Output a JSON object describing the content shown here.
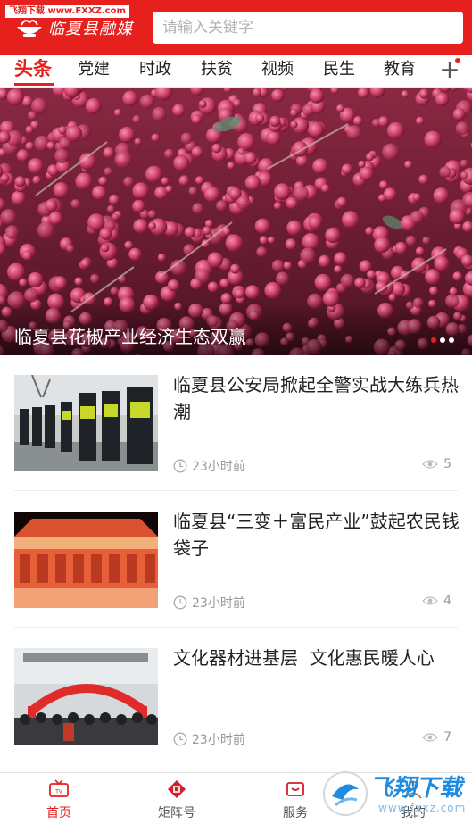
{
  "watermark_top": "飞翔下载 www.FXXZ.com",
  "header": {
    "app_name": "临夏县融媒",
    "search_placeholder": "请输入关键字"
  },
  "tabs": [
    {
      "label": "头条",
      "active": true
    },
    {
      "label": "党建"
    },
    {
      "label": "时政"
    },
    {
      "label": "扶贫"
    },
    {
      "label": "视频"
    },
    {
      "label": "民生"
    },
    {
      "label": "教育"
    }
  ],
  "tab_add_label": "+",
  "banner": {
    "title": "临夏县花椒产业经济生态双赢",
    "slide_index": 1,
    "slide_count": 3
  },
  "news": [
    {
      "title": "临夏县公安局掀起全警实战大练兵热潮",
      "time": "23小时前",
      "views": "5"
    },
    {
      "title": "临夏县“三变＋富民产业”鼓起农民钱袋子",
      "time": "23小时前",
      "views": "4"
    },
    {
      "title": "文化器材进基层  文化惠民暖人心",
      "time": "23小时前",
      "views": "7"
    }
  ],
  "bottom_nav": [
    {
      "label": "首页",
      "icon": "tv-icon",
      "active": true
    },
    {
      "label": "矩阵号",
      "icon": "matrix-icon"
    },
    {
      "label": "服务",
      "icon": "service-icon"
    },
    {
      "label": "我的",
      "icon": "profile-icon"
    }
  ],
  "watermark_bottom": {
    "text": "飞翔下载",
    "url": "www.fxxz.com"
  },
  "colors": {
    "brand_red": "#e6211d",
    "watermark_blue": "#1c8be0"
  }
}
